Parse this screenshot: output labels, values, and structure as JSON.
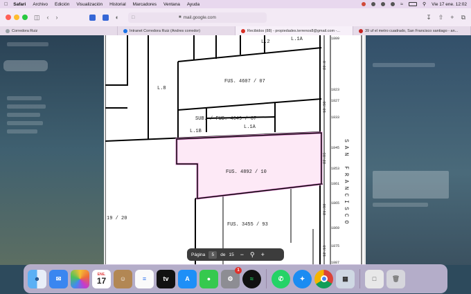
{
  "menubar": {
    "app": "Safari",
    "items": [
      "Archivo",
      "Edición",
      "Visualización",
      "Historial",
      "Marcadores",
      "Ventana",
      "Ayuda"
    ],
    "datetime": "Vie 17 ene.  12:02"
  },
  "browser": {
    "url": "mail.google.com",
    "tabs": [
      {
        "title": "Corredora Ruiz",
        "color": "#9aa0a6"
      },
      {
        "title": "Intranet Corredora Ruiz (Andres corredor)",
        "color": "#1a73e8"
      },
      {
        "title": "Recibidos (88) - propiedades.terrenos8@gmail.com -...",
        "color": "#d93025"
      },
      {
        "title": "39 uf el metro cuadrado, San Francisco santiago - an...",
        "color": "#c5221f"
      }
    ]
  },
  "document": {
    "lots": [
      {
        "label": "FUS. 4607 / 07"
      },
      {
        "label": "L.8"
      },
      {
        "label": "L.2"
      },
      {
        "label": "L.1A"
      },
      {
        "label": "SUB. / FUS. 4649 / 07"
      },
      {
        "label": "L.1B"
      },
      {
        "label": "L.1A"
      },
      {
        "label": "FUS. 4892 / 10"
      },
      {
        "label": "FUS. 3455 / 93"
      },
      {
        "label": "19 / 20"
      }
    ],
    "street": "SAN FRANCISCO",
    "street_numbers": [
      "1809",
      "1823",
      "1827",
      "1833",
      "1845",
      "1853",
      "1861",
      "1865",
      "1869",
      "1875",
      "1887"
    ],
    "dims": [
      "20.0",
      "10.30",
      "22.85",
      "21.80",
      "12.18"
    ]
  },
  "pdf_controls": {
    "page_label": "Página",
    "page": "5",
    "of_label": "de",
    "total": "15"
  },
  "dock": {
    "calendar_month": "ENE.",
    "calendar_day": "17",
    "settings_badge": "1"
  }
}
